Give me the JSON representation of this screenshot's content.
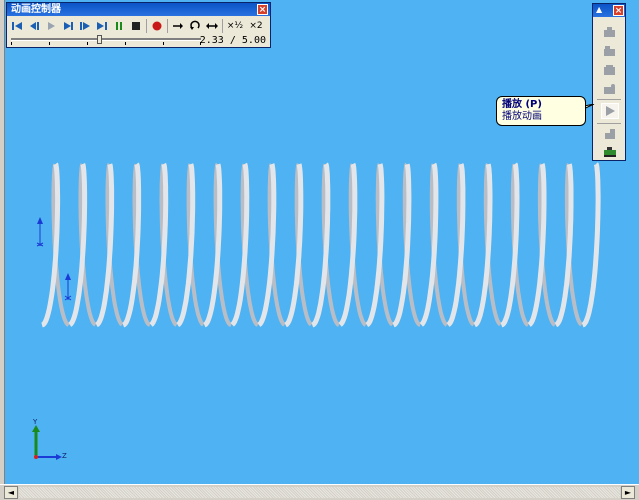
{
  "anim_controller": {
    "title": "动画控制器",
    "time_current": "2.33",
    "time_total": "5.00",
    "time_separator": "/",
    "progress": 0.466,
    "speed_label_a": "×½",
    "speed_label_b": "×2",
    "icons": [
      "rewind-start-icon",
      "step-back-icon",
      "play-back-icon",
      "play-icon",
      "step-forward-icon",
      "forward-end-icon",
      "pause-icon",
      "stop-icon",
      "record-icon",
      "playback-normal-icon",
      "loop-icon",
      "reciprocate-icon",
      "half-speed-icon",
      "double-speed-icon"
    ]
  },
  "right_toolbar": {
    "menu_glyph": "▲",
    "close_glyph": "×",
    "icons": [
      "camera-icon",
      "camera-icon-2",
      "camera-icon-3",
      "camera-icon-4",
      "play-animation-icon",
      "physical-simulation-icon",
      "save-animation-icon"
    ]
  },
  "tooltip": {
    "title": "播放 (P)",
    "description": "播放动画"
  },
  "triad": {
    "y_label": "Y",
    "z_label": "Z"
  },
  "colors": {
    "viewport_bg": "#4fb2f2",
    "spring": "#e2e6ea",
    "titlebar": "#0a54c8"
  },
  "scrollbar": {
    "left_arrow": "◄",
    "right_arrow": "►"
  }
}
